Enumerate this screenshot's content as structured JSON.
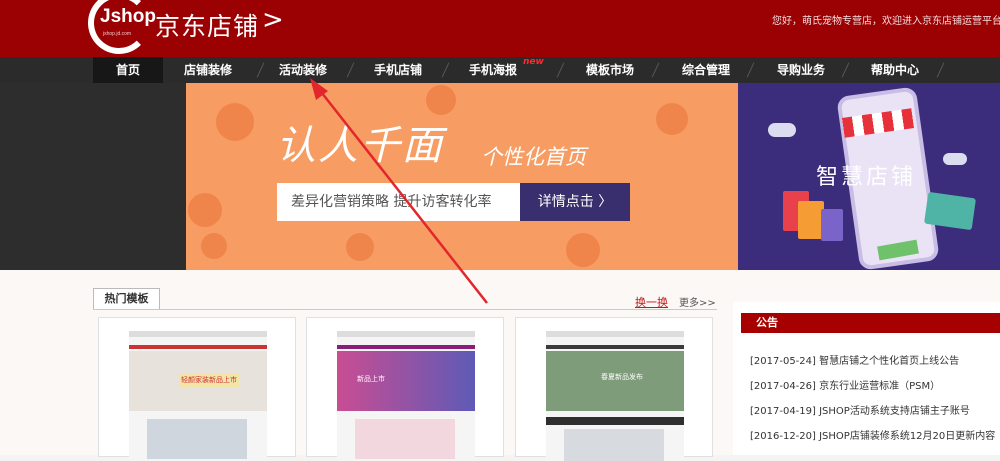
{
  "header": {
    "logo_mark": "Jshop",
    "logo_sub": "jshop.jd.com",
    "logo_title": "京东店铺",
    "welcome": "您好，萌氏宠物专营店，欢迎进入京东店铺运营平台"
  },
  "nav": {
    "items": [
      {
        "label": "首页"
      },
      {
        "label": "店铺装修"
      },
      {
        "label": "活动装修"
      },
      {
        "label": "手机店铺"
      },
      {
        "label": "手机海报"
      },
      {
        "label": "模板市场"
      },
      {
        "label": "综合管理"
      },
      {
        "label": "导购业务"
      },
      {
        "label": "帮助中心"
      }
    ],
    "new_badge": "new"
  },
  "banner": {
    "headline": "认人千面",
    "headline_sub": "个性化首页",
    "tagline": "差异化营销策略  提升访客转化率",
    "cta": "详情点击 〉",
    "right_title": "智慧店铺"
  },
  "hot_templates": {
    "tab": "热门模板",
    "swap": "换一换",
    "more": "更多>>",
    "thumb_texts": [
      "轻颜家装新品上市",
      "新品上市",
      "春夏新品发布"
    ]
  },
  "notice": {
    "title": "公告",
    "items": [
      "[2017-05-24]  智慧店铺之个性化首页上线公告",
      "[2017-04-26]  京东行业运营标准（PSM）",
      "[2017-04-19]  JSHOP活动系统支持店铺主子账号",
      "[2016-12-20]  JSHOP店铺装修系统12月20日更新内容"
    ]
  },
  "colors": {
    "header_red": "#9b0003",
    "nav_dark": "#2b2b2b",
    "banner_orange": "#f79c62",
    "banner_purple": "#3b2d7c",
    "arrow_red": "#e3262b"
  }
}
